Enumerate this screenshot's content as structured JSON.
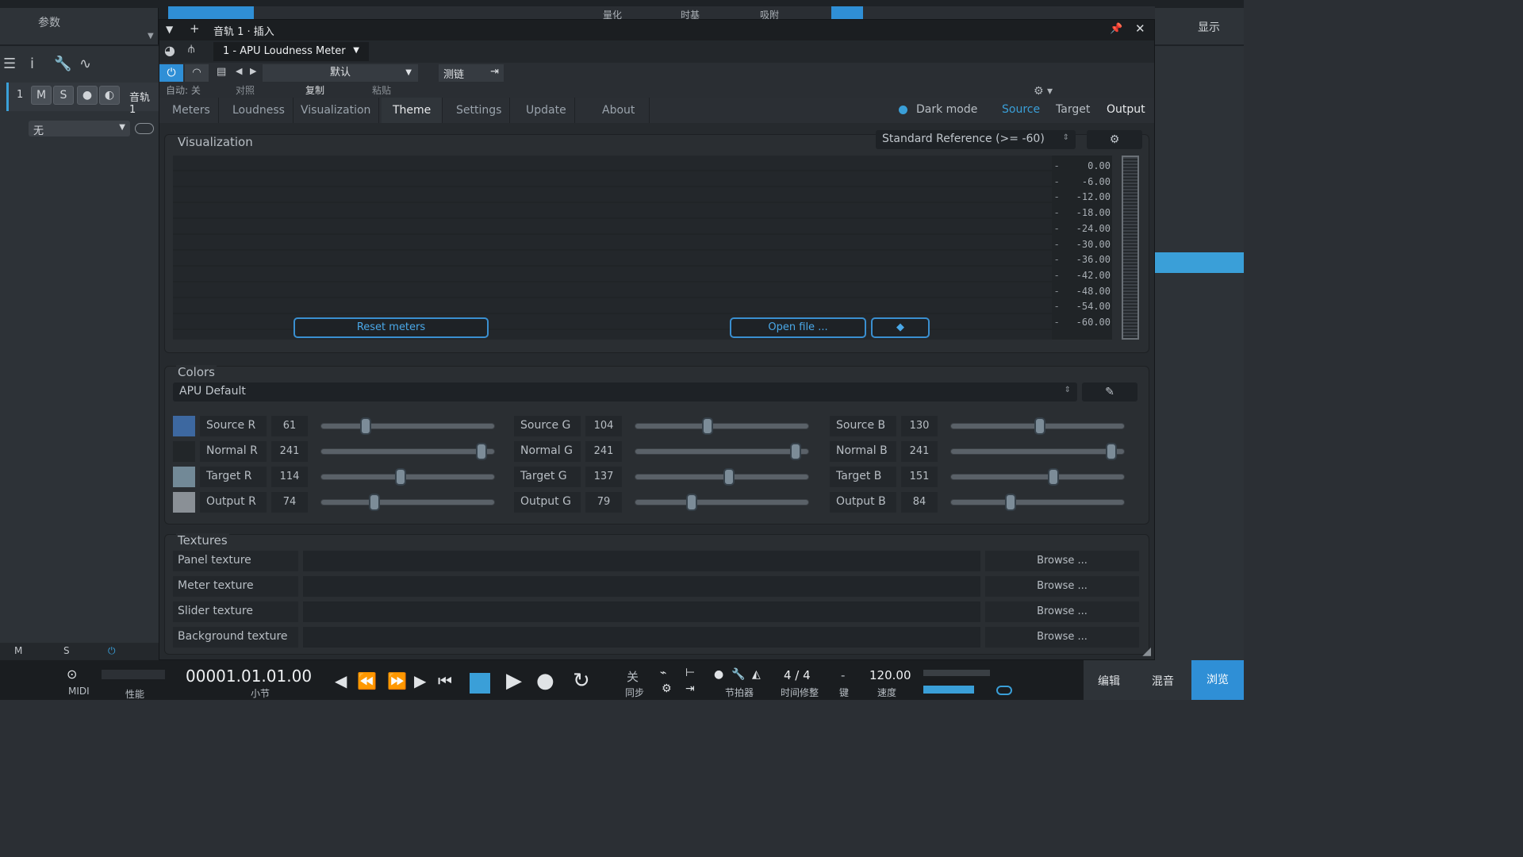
{
  "daw": {
    "params_tab": "参数",
    "display_tab": "显示",
    "top_strip": [
      "量化",
      "时基",
      "吸附"
    ],
    "track": {
      "number": "1",
      "m": "M",
      "s": "S",
      "name": "音轨 1",
      "input": "无"
    },
    "bottom_ms": {
      "m": "M",
      "s": "S"
    }
  },
  "plugin": {
    "window_title": "音轨 1 · 插入",
    "preset_name": "1 - APU Loudness Meter",
    "auto_label": "自动: 关",
    "preset_select": "默认",
    "compare": "对照",
    "copy": "复制",
    "paste": "粘贴",
    "sidechain": "测链",
    "tabs": [
      "Meters",
      "Loudness",
      "Visualization",
      "Theme",
      "Settings",
      "Update",
      "About"
    ],
    "active_tab": "Theme",
    "dark_mode": "Dark mode",
    "source": "Source",
    "target": "Target",
    "output": "Output",
    "colors": {
      "source": "#3a9fd8",
      "active_blue": "#2f8fd6"
    }
  },
  "visualization": {
    "title": "Visualization",
    "reference": "Standard Reference (>= -60)",
    "scale": [
      "0.00",
      "-6.00",
      "-12.00",
      "-18.00",
      "-24.00",
      "-30.00",
      "-36.00",
      "-42.00",
      "-48.00",
      "-54.00",
      "-60.00"
    ],
    "reset": "Reset meters",
    "open_file": "Open file ..."
  },
  "colors_panel": {
    "title": "Colors",
    "preset": "APU Default",
    "rows": [
      {
        "swatch": "#3d68a0",
        "r_label": "Source R",
        "r": "61",
        "g_label": "Source G",
        "g": "104",
        "b_label": "Source B",
        "b": "130",
        "rf": 0.24,
        "gf": 0.41,
        "bf": 0.51
      },
      {
        "swatch": "#222629",
        "r_label": "Normal R",
        "r": "241",
        "g_label": "Normal G",
        "g": "241",
        "b_label": "Normal B",
        "b": "241",
        "rf": 0.945,
        "gf": 0.945,
        "bf": 0.945
      },
      {
        "swatch": "#728997",
        "r_label": "Target R",
        "r": "114",
        "g_label": "Target G",
        "g": "137",
        "b_label": "Target B",
        "b": "151",
        "rf": 0.45,
        "gf": 0.54,
        "bf": 0.59
      },
      {
        "swatch": "#8a9096",
        "r_label": "Output R",
        "r": "74",
        "g_label": "Output G",
        "g": "79",
        "b_label": "Output B",
        "b": "84",
        "rf": 0.29,
        "gf": 0.31,
        "bf": 0.33
      }
    ]
  },
  "textures": {
    "title": "Textures",
    "browse": "Browse ...",
    "items": [
      "Panel texture",
      "Meter texture",
      "Slider texture",
      "Background texture"
    ]
  },
  "transport": {
    "midi": "MIDI",
    "perf": "性能",
    "position": "00001.01.01.00",
    "position_unit": "小节",
    "off": "关",
    "sync": "同步",
    "metronome": "节拍器",
    "time_sig": "4 / 4",
    "time_fix": "时间修整",
    "key_dash": "-",
    "key": "键",
    "tempo": "120.00",
    "tempo_label": "速度",
    "edit": "编辑",
    "mix": "混音",
    "browse": "浏览"
  }
}
